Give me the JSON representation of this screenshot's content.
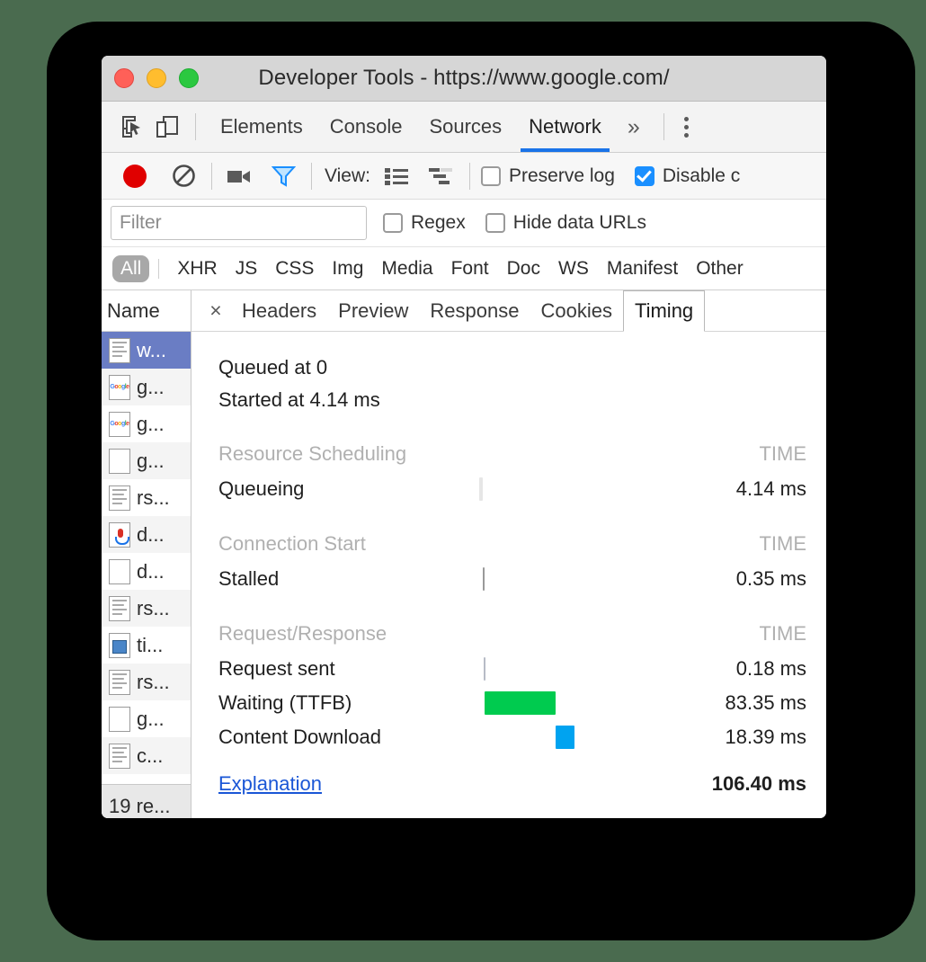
{
  "window": {
    "title": "Developer Tools - https://www.google.com/",
    "traffic_lights": [
      "close-red",
      "minimize-yellow",
      "zoom-green"
    ]
  },
  "panel_tabs": {
    "inspect_icon": "inspect-cursor-icon",
    "device_icon": "device-toolbar-icon",
    "items": [
      {
        "label": "Elements",
        "active": false
      },
      {
        "label": "Console",
        "active": false
      },
      {
        "label": "Sources",
        "active": false
      },
      {
        "label": "Network",
        "active": true
      }
    ],
    "more_label": "»",
    "menu_icon": "kebab-menu-icon",
    "accent": "#1a73e8"
  },
  "network_toolbar": {
    "record_icon": "record-icon",
    "clear_icon": "clear-icon",
    "camera_icon": "camera-icon",
    "filter_icon": "filter-funnel-icon",
    "view_label": "View:",
    "list_view_icon": "list-view-icon",
    "waterfall_view_icon": "waterfall-view-icon",
    "preserve_log": {
      "label": "Preserve log",
      "checked": false
    },
    "disable_cache": {
      "label": "Disable c",
      "checked": true
    },
    "checked_color": "#1a8fff"
  },
  "filter_row": {
    "input_placeholder": "Filter",
    "input_value": "",
    "regex": {
      "label": "Regex",
      "checked": false
    },
    "hide_data_urls": {
      "label": "Hide data URLs",
      "checked": false
    }
  },
  "type_filters": {
    "selected": "All",
    "items": [
      "All",
      "XHR",
      "JS",
      "CSS",
      "Img",
      "Media",
      "Font",
      "Doc",
      "WS",
      "Manifest",
      "Other"
    ]
  },
  "requests_panel": {
    "column_header": "Name",
    "status_text": "19 re...",
    "rows": [
      {
        "name": "w...",
        "icon": "document-icon",
        "selected": true
      },
      {
        "name": "g...",
        "icon": "google-image-icon",
        "selected": false
      },
      {
        "name": "g...",
        "icon": "google-image-icon",
        "selected": false
      },
      {
        "name": "g...",
        "icon": "blank-file-icon",
        "selected": false
      },
      {
        "name": "rs...",
        "icon": "document-icon",
        "selected": false
      },
      {
        "name": "d...",
        "icon": "microphone-image-icon",
        "selected": false
      },
      {
        "name": "d...",
        "icon": "blank-file-icon",
        "selected": false
      },
      {
        "name": "rs...",
        "icon": "document-icon",
        "selected": false
      },
      {
        "name": "ti...",
        "icon": "image-file-icon",
        "selected": false
      },
      {
        "name": "rs...",
        "icon": "document-icon",
        "selected": false
      },
      {
        "name": "g...",
        "icon": "blank-file-icon",
        "selected": false
      },
      {
        "name": "c...",
        "icon": "document-icon",
        "selected": false
      }
    ]
  },
  "detail_tabs": {
    "close_label": "×",
    "items": [
      {
        "label": "Headers",
        "active": false
      },
      {
        "label": "Preview",
        "active": false
      },
      {
        "label": "Response",
        "active": false
      },
      {
        "label": "Cookies",
        "active": false
      },
      {
        "label": "Timing",
        "active": true
      }
    ]
  },
  "timing": {
    "queued_at": "Queued at 0",
    "started_at": "Started at 4.14 ms",
    "time_header": "TIME",
    "sections": [
      {
        "name": "Resource Scheduling",
        "rows": [
          {
            "label": "Queueing",
            "value": "4.14 ms",
            "bar_color": "#e6e6e6",
            "bar_left_pct": 0.0,
            "bar_width_pct": 2.0
          }
        ]
      },
      {
        "name": "Connection Start",
        "rows": [
          {
            "label": "Stalled",
            "value": "0.35 ms",
            "bar_color": "#9a9a9a",
            "bar_left_pct": 2.1,
            "bar_width_pct": 0.7
          }
        ]
      },
      {
        "name": "Request/Response",
        "rows": [
          {
            "label": "Request sent",
            "value": "0.18 ms",
            "bar_color": "#b7bcc6",
            "bar_left_pct": 2.4,
            "bar_width_pct": 0.7
          },
          {
            "label": "Waiting (TTFB)",
            "value": "83.35 ms",
            "bar_color": "#00cb4f",
            "bar_left_pct": 2.7,
            "bar_width_pct": 37.0
          },
          {
            "label": "Content Download",
            "value": "18.39 ms",
            "bar_color": "#00a3f0",
            "bar_left_pct": 39.7,
            "bar_width_pct": 10.0
          }
        ]
      }
    ],
    "explanation_label": "Explanation",
    "total": "106.40 ms"
  }
}
